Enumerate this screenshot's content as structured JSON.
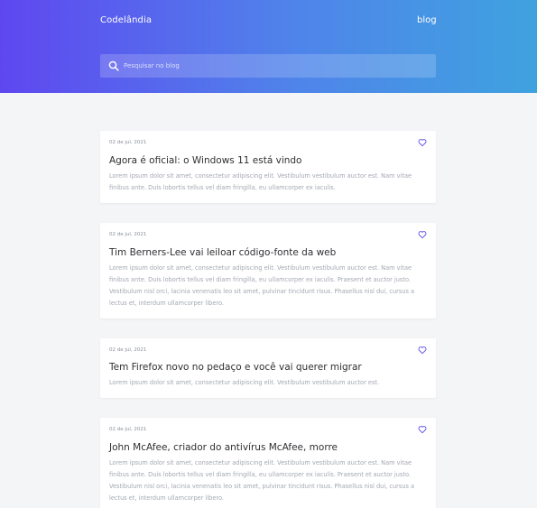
{
  "header": {
    "brand": "Codelândia",
    "nav_blog": "blog",
    "search_placeholder": "Pesquisar no blog",
    "search_value": ""
  },
  "colors": {
    "gradient_start": "#5f47f0",
    "gradient_end": "#3fa2df",
    "heart": "#5b4ee8",
    "page_bg": "#f4f5f7"
  },
  "icons": {
    "search": "search-icon",
    "favorite": "heart-icon"
  },
  "posts": [
    {
      "date": "02 de jul, 2021",
      "title": "Agora é oficial: o Windows 11 está vindo",
      "excerpt": "Lorem ipsum dolor sit amet, consectetur adipiscing elit. Vestibulum vestibulum auctor est. Nam vitae finibus ante. Duis lobortis tellus vel diam fringilla, eu ullamcorper ex iaculis."
    },
    {
      "date": "02 de jul, 2021",
      "title": "Tim Berners-Lee vai leiloar código-fonte da web",
      "excerpt": "Lorem ipsum dolor sit amet, consectetur adipiscing elit. Vestibulum vestibulum auctor est. Nam vitae finibus ante. Duis lobortis tellus vel diam fringilla, eu ullamcorper ex iaculis. Praesent et auctor justo. Vestibulum nisl orci, lacinia venenatis leo sit amet, pulvinar tincidunt risus. Phasellus nisl dui, cursus a lectus et, interdum ullamcorper libero."
    },
    {
      "date": "02 de jul, 2021",
      "title": "Tem Firefox novo no pedaço e você vai querer migrar",
      "excerpt": "Lorem ipsum dolor sit amet, consectetur adipiscing elit. Vestibulum vestibulum auctor est."
    },
    {
      "date": "02 de jul, 2021",
      "title": "John McAfee, criador do antivírus McAfee, morre",
      "excerpt": "Lorem ipsum dolor sit amet, consectetur adipiscing elit. Vestibulum vestibulum auctor est. Nam vitae finibus ante. Duis lobortis tellus vel diam fringilla, eu ullamcorper ex iaculis. Praesent et auctor justo. Vestibulum nisl orci, lacinia venenatis leo sit amet, pulvinar tincidunt risus. Phasellus nisl dui, cursus a lectus et, interdum ullamcorper libero."
    }
  ]
}
